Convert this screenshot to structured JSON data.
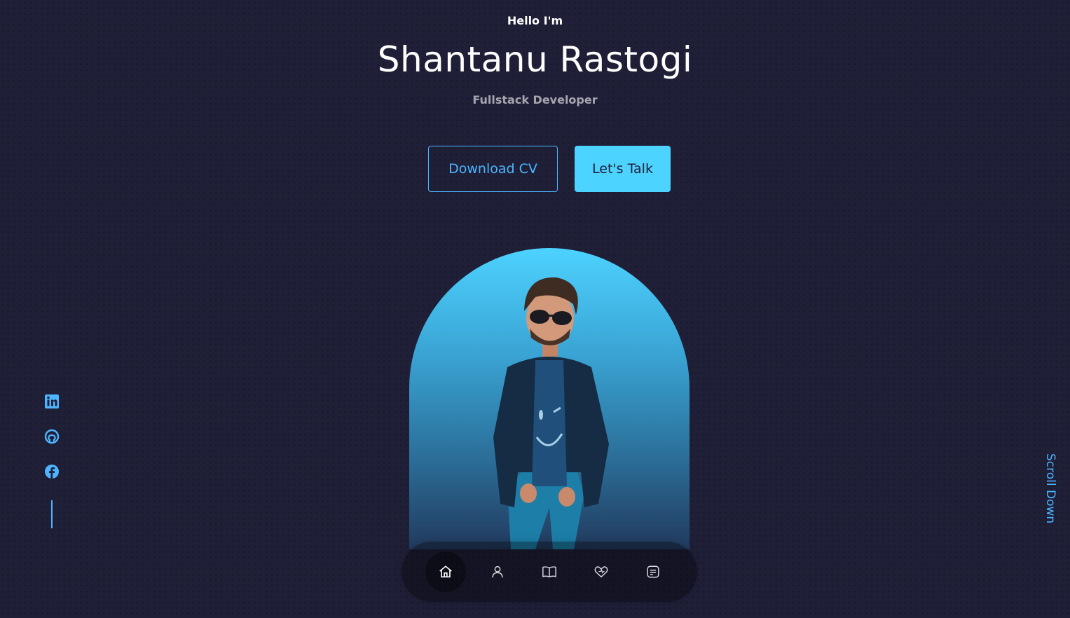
{
  "header": {
    "greeting": "Hello I'm",
    "name": "Shantanu Rastogi",
    "role": "Fullstack Developer"
  },
  "cta": {
    "download_cv": "Download CV",
    "lets_talk": "Let's Talk"
  },
  "socials": {
    "items": [
      {
        "icon": "linkedin-icon"
      },
      {
        "icon": "github-icon"
      },
      {
        "icon": "facebook-icon"
      }
    ]
  },
  "scroll_down": "Scroll Down",
  "nav": {
    "items": [
      {
        "icon": "home-icon",
        "active": true
      },
      {
        "icon": "user-icon",
        "active": false
      },
      {
        "icon": "book-icon",
        "active": false
      },
      {
        "icon": "services-icon",
        "active": false
      },
      {
        "icon": "message-icon",
        "active": false
      }
    ]
  },
  "colors": {
    "background": "#1f1f38",
    "accent": "#4db5ff",
    "primary_button": "#4dd3ff",
    "text_light": "#ffffff"
  }
}
